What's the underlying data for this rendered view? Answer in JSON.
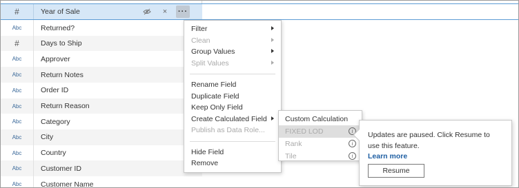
{
  "field_list": {
    "header": {
      "type_icon": "#",
      "name": "Year of Sale",
      "tools": {
        "hide_icon": "eye-slash",
        "close": "×",
        "more": "···"
      }
    },
    "rows": [
      {
        "type": "Abc",
        "name": "Returned?"
      },
      {
        "type": "#",
        "name": "Days to Ship"
      },
      {
        "type": "Abc",
        "name": "Approver"
      },
      {
        "type": "Abc",
        "name": "Return Notes"
      },
      {
        "type": "Abc",
        "name": "Order ID"
      },
      {
        "type": "Abc",
        "name": "Return Reason"
      },
      {
        "type": "Abc",
        "name": "Category"
      },
      {
        "type": "Abc",
        "name": "City"
      },
      {
        "type": "Abc",
        "name": "Country"
      },
      {
        "type": "Abc",
        "name": "Customer ID"
      },
      {
        "type": "Abc",
        "name": "Customer Name"
      }
    ]
  },
  "context_menu": {
    "filter": "Filter",
    "clean": "Clean",
    "group_values": "Group Values",
    "split_values": "Split Values",
    "rename_field": "Rename Field",
    "duplicate_field": "Duplicate Field",
    "keep_only_field": "Keep Only Field",
    "create_calculated_field": "Create Calculated Field",
    "publish_as_data_role": "Publish as Data Role...",
    "hide_field": "Hide Field",
    "remove": "Remove"
  },
  "calc_submenu": {
    "custom_calculation": "Custom Calculation",
    "fixed_lod": "FIXED LOD",
    "rank": "Rank",
    "tile": "Tile",
    "info_glyph": "i"
  },
  "tooltip": {
    "message": "Updates are paused. Click Resume to use this feature.",
    "learn_more": "Learn more",
    "resume_button": "Resume"
  }
}
